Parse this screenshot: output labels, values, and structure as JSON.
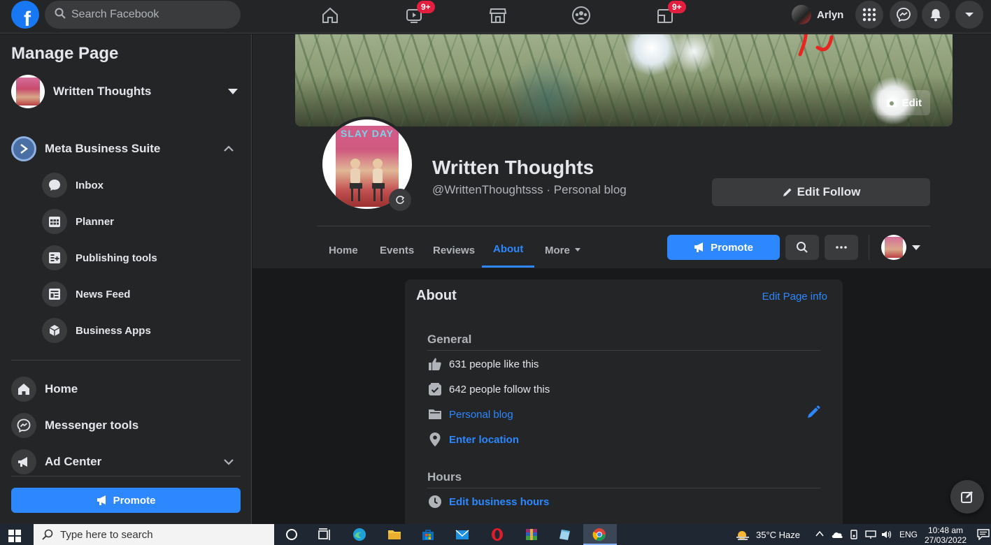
{
  "topbar": {
    "search_placeholder": "Search Facebook",
    "video_badge": "9+",
    "gaming_badge": "9+",
    "user_name": "Arlyn",
    "logo_letter": "f"
  },
  "sidebar": {
    "title": "Manage Page",
    "page_name": "Written Thoughts",
    "business_suite": "Meta Business Suite",
    "sub_items": [
      {
        "label": "Inbox",
        "icon": "chat-bubble-icon"
      },
      {
        "label": "Planner",
        "icon": "calendar-grid-icon"
      },
      {
        "label": "Publishing tools",
        "icon": "publishing-tools-icon"
      },
      {
        "label": "News Feed",
        "icon": "news-feed-icon"
      },
      {
        "label": "Business Apps",
        "icon": "cube-icon"
      }
    ],
    "main_items": [
      {
        "label": "Home",
        "icon": "home-icon"
      },
      {
        "label": "Messenger tools",
        "icon": "messenger-icon"
      },
      {
        "label": "Ad Center",
        "icon": "megaphone-icon"
      }
    ],
    "promote_label": "Promote"
  },
  "header": {
    "cover_edit": "Edit",
    "page_title": "Written Thoughts",
    "page_subtitle": "@WrittenThoughtsss · Personal blog",
    "edit_follow": "Edit Follow",
    "profile_art_text": "SLAY DAY",
    "tabs": [
      {
        "label": "Home"
      },
      {
        "label": "Events"
      },
      {
        "label": "Reviews"
      },
      {
        "label": "About"
      },
      {
        "label": "More"
      }
    ],
    "active_tab": "About",
    "promote_label": "Promote"
  },
  "about": {
    "title": "About",
    "edit_info": "Edit Page info",
    "general_title": "General",
    "likes": "631 people like this",
    "follows": "642 people follow this",
    "category": "Personal blog",
    "location": "Enter location",
    "hours_title": "Hours",
    "hours_link": "Edit business hours"
  },
  "taskbar": {
    "search_placeholder": "Type here to search",
    "weather": "35°C  Haze",
    "language": "ENG",
    "time": "10:48 am",
    "date": "27/03/2022"
  },
  "colors": {
    "accent": "#2d88ff",
    "surface": "#242526",
    "background": "#18191a",
    "badge": "#e41e3f"
  }
}
